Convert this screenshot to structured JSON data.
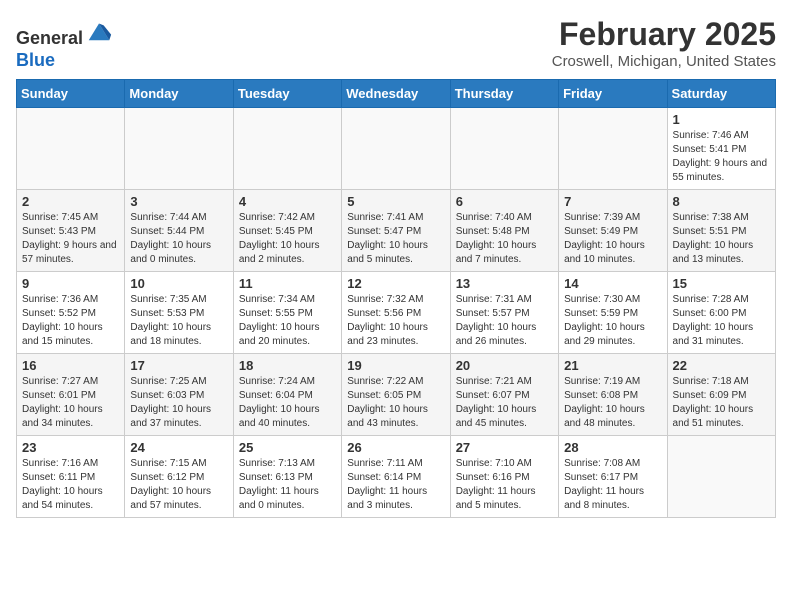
{
  "header": {
    "logo_line1": "General",
    "logo_line2": "Blue",
    "month": "February 2025",
    "location": "Croswell, Michigan, United States"
  },
  "weekdays": [
    "Sunday",
    "Monday",
    "Tuesday",
    "Wednesday",
    "Thursday",
    "Friday",
    "Saturday"
  ],
  "weeks": [
    [
      {
        "day": "",
        "info": ""
      },
      {
        "day": "",
        "info": ""
      },
      {
        "day": "",
        "info": ""
      },
      {
        "day": "",
        "info": ""
      },
      {
        "day": "",
        "info": ""
      },
      {
        "day": "",
        "info": ""
      },
      {
        "day": "1",
        "info": "Sunrise: 7:46 AM\nSunset: 5:41 PM\nDaylight: 9 hours and 55 minutes."
      }
    ],
    [
      {
        "day": "2",
        "info": "Sunrise: 7:45 AM\nSunset: 5:43 PM\nDaylight: 9 hours and 57 minutes."
      },
      {
        "day": "3",
        "info": "Sunrise: 7:44 AM\nSunset: 5:44 PM\nDaylight: 10 hours and 0 minutes."
      },
      {
        "day": "4",
        "info": "Sunrise: 7:42 AM\nSunset: 5:45 PM\nDaylight: 10 hours and 2 minutes."
      },
      {
        "day": "5",
        "info": "Sunrise: 7:41 AM\nSunset: 5:47 PM\nDaylight: 10 hours and 5 minutes."
      },
      {
        "day": "6",
        "info": "Sunrise: 7:40 AM\nSunset: 5:48 PM\nDaylight: 10 hours and 7 minutes."
      },
      {
        "day": "7",
        "info": "Sunrise: 7:39 AM\nSunset: 5:49 PM\nDaylight: 10 hours and 10 minutes."
      },
      {
        "day": "8",
        "info": "Sunrise: 7:38 AM\nSunset: 5:51 PM\nDaylight: 10 hours and 13 minutes."
      }
    ],
    [
      {
        "day": "9",
        "info": "Sunrise: 7:36 AM\nSunset: 5:52 PM\nDaylight: 10 hours and 15 minutes."
      },
      {
        "day": "10",
        "info": "Sunrise: 7:35 AM\nSunset: 5:53 PM\nDaylight: 10 hours and 18 minutes."
      },
      {
        "day": "11",
        "info": "Sunrise: 7:34 AM\nSunset: 5:55 PM\nDaylight: 10 hours and 20 minutes."
      },
      {
        "day": "12",
        "info": "Sunrise: 7:32 AM\nSunset: 5:56 PM\nDaylight: 10 hours and 23 minutes."
      },
      {
        "day": "13",
        "info": "Sunrise: 7:31 AM\nSunset: 5:57 PM\nDaylight: 10 hours and 26 minutes."
      },
      {
        "day": "14",
        "info": "Sunrise: 7:30 AM\nSunset: 5:59 PM\nDaylight: 10 hours and 29 minutes."
      },
      {
        "day": "15",
        "info": "Sunrise: 7:28 AM\nSunset: 6:00 PM\nDaylight: 10 hours and 31 minutes."
      }
    ],
    [
      {
        "day": "16",
        "info": "Sunrise: 7:27 AM\nSunset: 6:01 PM\nDaylight: 10 hours and 34 minutes."
      },
      {
        "day": "17",
        "info": "Sunrise: 7:25 AM\nSunset: 6:03 PM\nDaylight: 10 hours and 37 minutes."
      },
      {
        "day": "18",
        "info": "Sunrise: 7:24 AM\nSunset: 6:04 PM\nDaylight: 10 hours and 40 minutes."
      },
      {
        "day": "19",
        "info": "Sunrise: 7:22 AM\nSunset: 6:05 PM\nDaylight: 10 hours and 43 minutes."
      },
      {
        "day": "20",
        "info": "Sunrise: 7:21 AM\nSunset: 6:07 PM\nDaylight: 10 hours and 45 minutes."
      },
      {
        "day": "21",
        "info": "Sunrise: 7:19 AM\nSunset: 6:08 PM\nDaylight: 10 hours and 48 minutes."
      },
      {
        "day": "22",
        "info": "Sunrise: 7:18 AM\nSunset: 6:09 PM\nDaylight: 10 hours and 51 minutes."
      }
    ],
    [
      {
        "day": "23",
        "info": "Sunrise: 7:16 AM\nSunset: 6:11 PM\nDaylight: 10 hours and 54 minutes."
      },
      {
        "day": "24",
        "info": "Sunrise: 7:15 AM\nSunset: 6:12 PM\nDaylight: 10 hours and 57 minutes."
      },
      {
        "day": "25",
        "info": "Sunrise: 7:13 AM\nSunset: 6:13 PM\nDaylight: 11 hours and 0 minutes."
      },
      {
        "day": "26",
        "info": "Sunrise: 7:11 AM\nSunset: 6:14 PM\nDaylight: 11 hours and 3 minutes."
      },
      {
        "day": "27",
        "info": "Sunrise: 7:10 AM\nSunset: 6:16 PM\nDaylight: 11 hours and 5 minutes."
      },
      {
        "day": "28",
        "info": "Sunrise: 7:08 AM\nSunset: 6:17 PM\nDaylight: 11 hours and 8 minutes."
      },
      {
        "day": "",
        "info": ""
      }
    ]
  ]
}
